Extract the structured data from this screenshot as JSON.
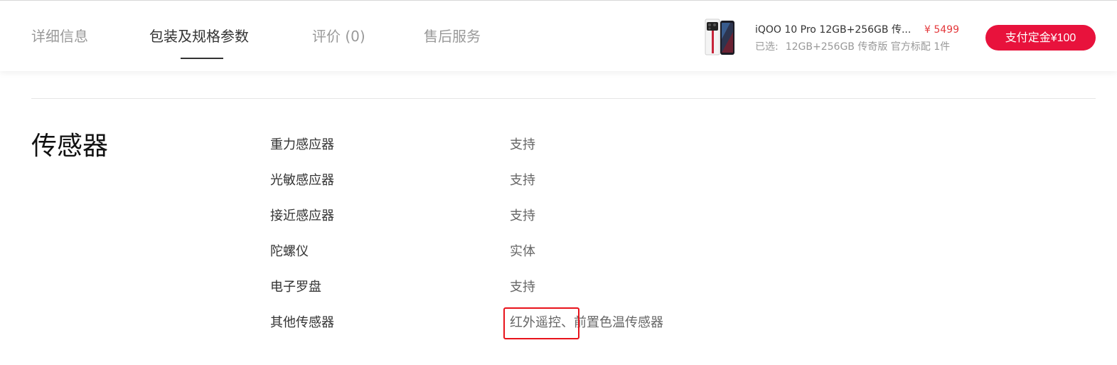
{
  "tabs": [
    {
      "label": "详细信息",
      "active": false
    },
    {
      "label": "包装及规格参数",
      "active": true
    },
    {
      "label": "评价 (0)",
      "active": false
    },
    {
      "label": "售后服务",
      "active": false
    }
  ],
  "product": {
    "name": "iQOO 10 Pro 12GB+256GB 传...",
    "price": "¥ 5499",
    "selected_prefix": "已选:",
    "selected_value": "12GB+256GB 传奇版 官方标配 1件",
    "thumbnail_icon": "phone-thumbnail-icon"
  },
  "pay_button": {
    "label": "支付定金¥100"
  },
  "section": {
    "title": "传感器",
    "specs": [
      {
        "label": "重力感应器",
        "value": "支持"
      },
      {
        "label": "光敏感应器",
        "value": "支持"
      },
      {
        "label": "接近感应器",
        "value": "支持"
      },
      {
        "label": "陀螺仪",
        "value": "实体"
      },
      {
        "label": "电子罗盘",
        "value": "支持"
      },
      {
        "label": "其他传感器",
        "value_highlight": "红外遥控、",
        "value_rest": "前置色温传感器"
      }
    ]
  },
  "colors": {
    "accent": "#e8123c",
    "price": "#e4393c",
    "highlight_border": "#e8131b"
  }
}
